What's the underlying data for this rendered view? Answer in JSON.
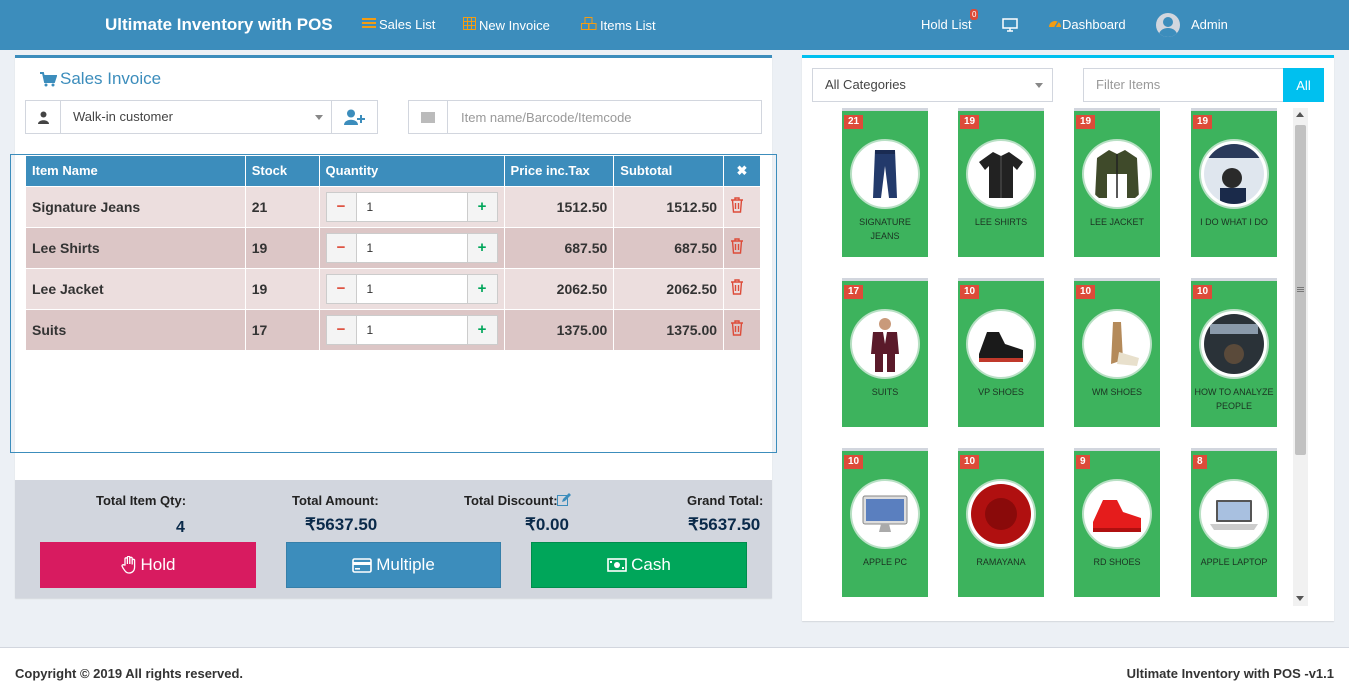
{
  "app": {
    "title": "Ultimate Inventory with POS"
  },
  "nav": {
    "sales_list": "Sales List",
    "new_invoice": "New Invoice",
    "items_list": "Items List",
    "hold_list": "Hold List",
    "hold_count": "0",
    "dashboard": "Dashboard",
    "user": "Admin"
  },
  "invoice": {
    "title": "Sales Invoice",
    "customer": "Walk-in customer",
    "item_search_placeholder": "Item name/Barcode/Itemcode",
    "columns": [
      "Item Name",
      "Stock",
      "Quantity",
      "Price inc.Tax",
      "Subtotal"
    ],
    "rows": [
      {
        "name": "Signature Jeans",
        "stock": "21",
        "qty": "1",
        "price": "1512.50",
        "subtotal": "1512.50"
      },
      {
        "name": "Lee Shirts",
        "stock": "19",
        "qty": "1",
        "price": "687.50",
        "subtotal": "687.50"
      },
      {
        "name": "Lee Jacket",
        "stock": "19",
        "qty": "1",
        "price": "2062.50",
        "subtotal": "2062.50"
      },
      {
        "name": "Suits",
        "stock": "17",
        "qty": "1",
        "price": "1375.00",
        "subtotal": "1375.00"
      }
    ]
  },
  "totals": {
    "qty_label": "Total Item Qty:",
    "qty_value": "4",
    "amount_label": "Total Amount:",
    "amount_value": "₹5637.50",
    "discount_label": "Total Discount:",
    "discount_value": "₹0.00",
    "grand_label": "Grand Total:",
    "grand_value": "₹5637.50"
  },
  "actions": {
    "hold": "Hold",
    "multiple": "Multiple",
    "cash": "Cash"
  },
  "catalog": {
    "category": "All Categories",
    "filter_placeholder": "Filter Items",
    "all_button": "All",
    "items": [
      {
        "stock": "21",
        "name": "SIGNATURE JEANS",
        "icon": "jeans-icon"
      },
      {
        "stock": "19",
        "name": "LEE SHIRTS",
        "icon": "shirt-icon"
      },
      {
        "stock": "19",
        "name": "LEE JACKET",
        "icon": "jacket-icon"
      },
      {
        "stock": "19",
        "name": "I DO WHAT I DO",
        "icon": "book-icon"
      },
      {
        "stock": "17",
        "name": "SUITS",
        "icon": "suit-icon"
      },
      {
        "stock": "10",
        "name": "VP SHOES",
        "icon": "shoe-icon"
      },
      {
        "stock": "10",
        "name": "WM SHOES",
        "icon": "loafer-icon"
      },
      {
        "stock": "10",
        "name": "HOW TO ANALYZE PEOPLE",
        "icon": "book-icon"
      },
      {
        "stock": "10",
        "name": "APPLE PC",
        "icon": "desktop-icon"
      },
      {
        "stock": "10",
        "name": "RAMAYANA",
        "icon": "book-icon"
      },
      {
        "stock": "9",
        "name": "RD SHOES",
        "icon": "shoe-icon"
      },
      {
        "stock": "8",
        "name": "APPLE LAPTOP",
        "icon": "laptop-icon"
      }
    ]
  },
  "colors": {
    "primary": "#3c8dbc",
    "hold": "#d81b60",
    "multiple": "#3c8dbc",
    "cash": "#00a65a",
    "card": "#3db35d",
    "info": "#00c0ef"
  },
  "footer": {
    "copyright": "Copyright © 2019 All rights reserved.",
    "version": "Ultimate Inventory with POS -v1.1"
  }
}
